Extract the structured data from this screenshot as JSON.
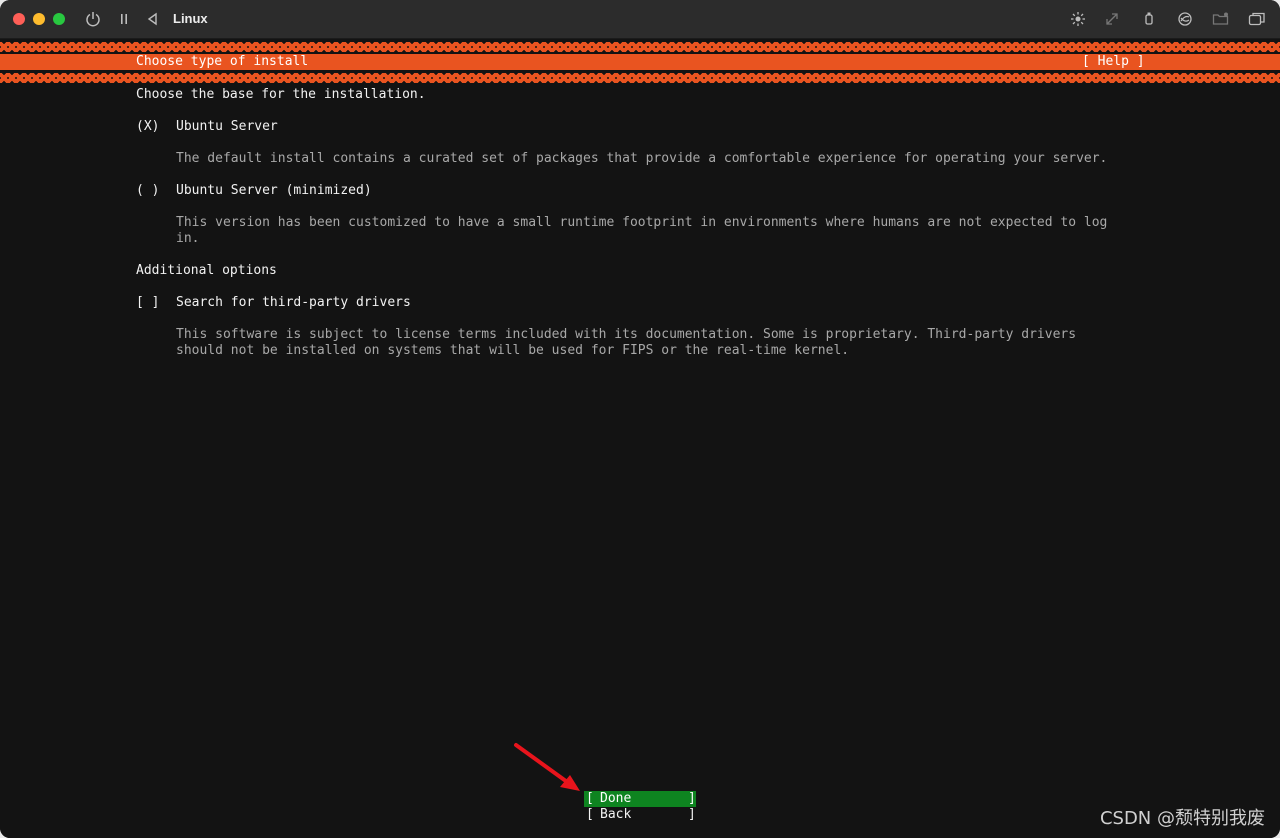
{
  "window": {
    "title": "Linux"
  },
  "header": {
    "title": "Choose type of install",
    "help": "[ Help ]"
  },
  "main": {
    "intro": "Choose the base for the installation.",
    "options": [
      {
        "marker": "(X)",
        "label": "Ubuntu Server",
        "description_lines": [
          "The default install contains a curated set of packages that provide a comfortable experience for operating your server."
        ]
      },
      {
        "marker": "( )",
        "label": "Ubuntu Server (minimized)",
        "description_lines": [
          "This version has been customized to have a small runtime footprint in environments where humans are not expected to log",
          "in."
        ]
      }
    ],
    "additional_heading": "Additional options",
    "additional": [
      {
        "marker": "[ ]",
        "label": "Search for third-party drivers",
        "description_lines": [
          "This software is subject to license terms included with its documentation. Some is proprietary. Third-party drivers",
          "should not be installed on systems that will be used for FIPS or the real-time kernel."
        ]
      }
    ]
  },
  "buttons": {
    "left_bracket": "[",
    "right_bracket": "]",
    "done": "Done",
    "back": "Back"
  },
  "watermark": "CSDN @颓特别我废",
  "colors": {
    "accent_orange": "#e95420",
    "selected_green": "#0e8420",
    "terminal_bg": "#131313",
    "text": "#f2f2f2",
    "dim_text": "#a8a8a8",
    "arrow_red": "#e8141c"
  },
  "icons": {
    "toolbar_left": [
      "power-icon",
      "pause-icon",
      "back-triangle-icon"
    ],
    "toolbar_right": [
      "brightness-icon",
      "resize-icon",
      "usb-icon",
      "network-icon",
      "shared-folder-icon",
      "windows-icon"
    ]
  }
}
